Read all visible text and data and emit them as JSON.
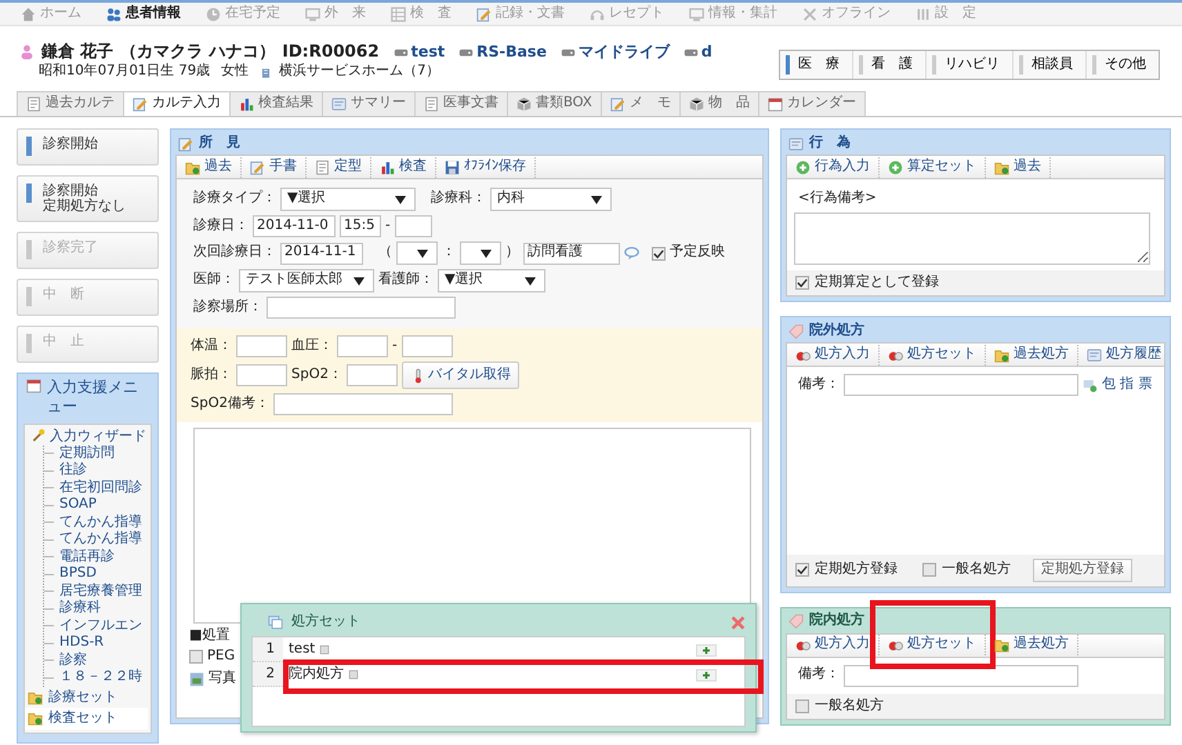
{
  "top_nav": [
    {
      "label": "ホーム",
      "kind": "home",
      "selected": false
    },
    {
      "label": "患者情報",
      "kind": "people",
      "selected": true
    },
    {
      "label": "在宅予定",
      "kind": "clock",
      "selected": false
    },
    {
      "label": "外　来",
      "kind": "monitor",
      "selected": false
    },
    {
      "label": "検　査",
      "kind": "grid",
      "selected": false
    },
    {
      "label": "記録・文書",
      "kind": "pencil",
      "selected": false
    },
    {
      "label": "レセプト",
      "kind": "headset",
      "selected": false
    },
    {
      "label": "情報・集計",
      "kind": "monitor",
      "selected": false
    },
    {
      "label": "オフライン",
      "kind": "cross",
      "selected": false
    },
    {
      "label": "設　定",
      "kind": "tools",
      "selected": false
    }
  ],
  "patient": {
    "name": "鎌倉 花子",
    "kana": "（カマクラ ハナコ）",
    "id": "ID:R00062",
    "links": [
      "test",
      "RS-Base",
      "マイドライブ",
      "d"
    ],
    "birth": "昭和10年07月01日生 79歳",
    "sex": "女性",
    "facility": "横浜サービスホーム（7）"
  },
  "role_tabs": [
    {
      "label": "医　療",
      "selected": true
    },
    {
      "label": "看　護",
      "selected": false
    },
    {
      "label": "リハビリ",
      "selected": false
    },
    {
      "label": "相談員",
      "selected": false
    },
    {
      "label": "その他",
      "selected": false
    }
  ],
  "tabs": [
    {
      "label": "過去カルテ",
      "kind": "doc",
      "selected": false
    },
    {
      "label": "カルテ入力",
      "kind": "pencil",
      "selected": true
    },
    {
      "label": "検査結果",
      "kind": "chart",
      "selected": false
    },
    {
      "label": "サマリー",
      "kind": "card",
      "selected": false
    },
    {
      "label": "医事文書",
      "kind": "doc",
      "selected": false
    },
    {
      "label": "書類BOX",
      "kind": "box",
      "selected": false
    },
    {
      "label": "メ　モ",
      "kind": "pencil",
      "selected": false
    },
    {
      "label": "物　品",
      "kind": "box",
      "selected": false
    },
    {
      "label": "カレンダー",
      "kind": "calendar",
      "selected": false
    }
  ],
  "actions": [
    {
      "label": "診察開始",
      "disabled": false
    },
    {
      "label": "診察開始",
      "sub": "定期処方なし",
      "disabled": false
    },
    {
      "label": "診察完了",
      "disabled": true
    },
    {
      "label": "中　断",
      "disabled": true
    },
    {
      "label": "中　止",
      "disabled": true
    }
  ],
  "support_menu": {
    "title": "入力支援メニュー",
    "tree": [
      {
        "label": "入力ウィザード",
        "kind": "wand",
        "expanded": true,
        "children": [
          {
            "label": "定期訪問"
          },
          {
            "label": "往診"
          },
          {
            "label": "在宅初回問診"
          },
          {
            "label": "SOAP"
          },
          {
            "label": "てんかん指導"
          },
          {
            "label": "てんかん指導"
          },
          {
            "label": "電話再診"
          },
          {
            "label": "BPSD"
          },
          {
            "label": "居宅療養管理"
          },
          {
            "label": "診療科"
          },
          {
            "label": "インフルエン"
          },
          {
            "label": "HDS-R"
          },
          {
            "label": "診察"
          },
          {
            "label": "１８－２２時"
          }
        ]
      },
      {
        "label": "診療セット",
        "kind": "folder"
      },
      {
        "label": "検査セット",
        "kind": "folder"
      }
    ]
  },
  "findings": {
    "title": "所　見",
    "toolbar": [
      {
        "label": "過去",
        "kind": "folder"
      },
      {
        "label": "手書",
        "kind": "pencil"
      },
      {
        "label": "定型",
        "kind": "doc"
      },
      {
        "label": "検査",
        "kind": "chart"
      },
      {
        "label": "ｵﾌﾗｲﾝ保存",
        "kind": "save"
      }
    ],
    "visit": {
      "type_label": "診療タイプ：",
      "type_value": "▼選択",
      "dept_label": "診療科：",
      "dept_value": "内科",
      "date_label": "診療日：",
      "date": "2014-11-0",
      "time": "15:5",
      "dash": "-",
      "next_label": "次回診療日：",
      "next_date": "2014-11-1",
      "paren_open": "（",
      "colon": "：",
      "paren_close": "）",
      "next_note": "訪問看護",
      "reflect": {
        "label": "予定反映",
        "checked": true
      },
      "doctor_label": "医師：",
      "doctor": "テスト医師太郎",
      "nurse_label": "看護師：",
      "nurse": "▼選択",
      "place_label": "診察場所："
    },
    "vitals": {
      "temp_label": "体温：",
      "bp_label": "血圧：",
      "dash": "-",
      "pulse_label": "脈拍：",
      "spo2_label": "SpO2：",
      "fetch_button": "バイタル取得",
      "spo2_note_label": "SpO2備考："
    },
    "treatment": {
      "heading": "■処置",
      "peg": {
        "label": "PEG",
        "checked": false
      },
      "photo": "写真"
    }
  },
  "rx_set_popup": {
    "title": "処方セット",
    "rows": [
      {
        "num": "1",
        "label": "test",
        "highlighted": false
      },
      {
        "num": "2",
        "label": "院内処方",
        "highlighted": true
      }
    ]
  },
  "acts": {
    "title": "行　為",
    "toolbar": [
      {
        "label": "行為入力",
        "kind": "plus"
      },
      {
        "label": "算定セット",
        "kind": "plus"
      },
      {
        "label": "過去",
        "kind": "folder"
      }
    ],
    "note_label": "<行為備考>",
    "regular": {
      "label": "定期算定として登録",
      "checked": true
    }
  },
  "outside_rx": {
    "title": "院外処方",
    "toolbar": [
      {
        "label": "処方入力",
        "kind": "pill"
      },
      {
        "label": "処方セット",
        "kind": "pill"
      },
      {
        "label": "過去処方",
        "kind": "folder"
      },
      {
        "label": "処方履歴",
        "kind": "card"
      }
    ],
    "note_label": "備考：",
    "pack_link": "包 指 票",
    "regular": {
      "label": "定期処方登録",
      "checked": true
    },
    "generic": {
      "label": "一般名処方",
      "checked": false
    },
    "register_button": "定期処方登録"
  },
  "inside_rx": {
    "title": "院内処方",
    "toolbar": [
      {
        "label": "処方入力",
        "kind": "pill",
        "highlighted": false
      },
      {
        "label": "処方セット",
        "kind": "pill",
        "highlighted": true
      },
      {
        "label": "過去処方",
        "kind": "folder",
        "highlighted": false
      }
    ],
    "note_label": "備考：",
    "generic": {
      "label": "一般名処方",
      "checked": false
    }
  }
}
